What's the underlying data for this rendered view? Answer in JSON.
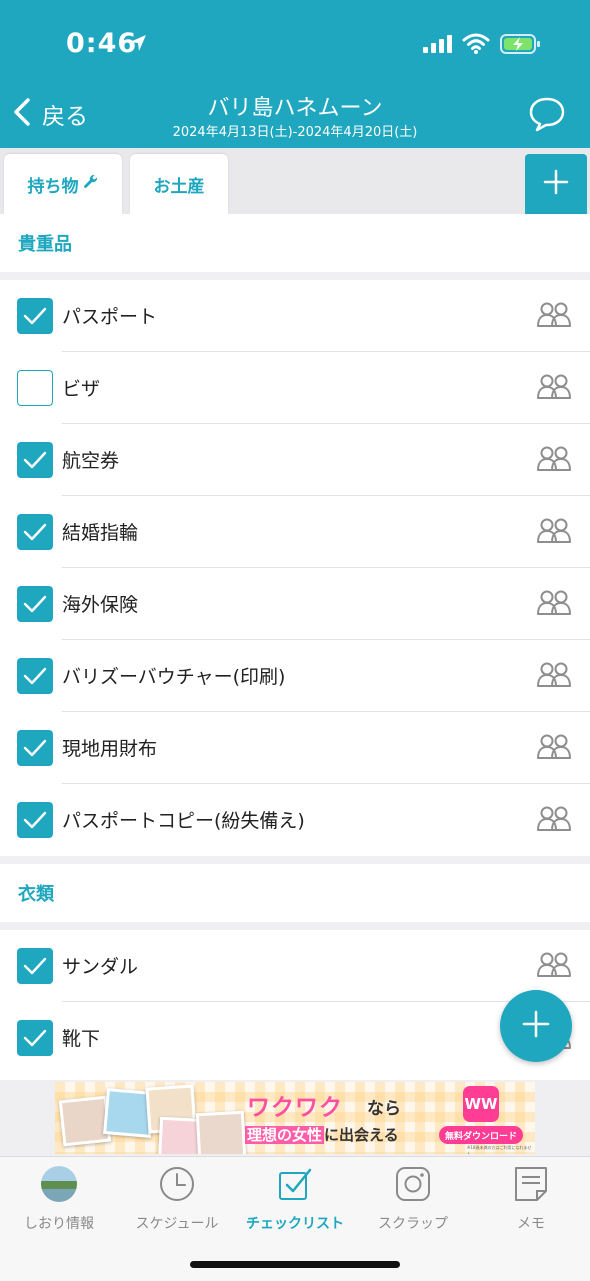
{
  "status_bar": {
    "time": "0:46"
  },
  "header": {
    "back_label": "戻る",
    "title": "バリ島ハネムーン",
    "dates": "2024年4月13日(土)-2024年4月20日(土)"
  },
  "tabs": [
    {
      "label": "持ち物"
    },
    {
      "label": "お土産"
    }
  ],
  "sections": [
    {
      "title": "貴重品",
      "items": [
        {
          "label": "パスポート",
          "checked": true
        },
        {
          "label": "ビザ",
          "checked": false
        },
        {
          "label": "航空券",
          "checked": true
        },
        {
          "label": "結婚指輪",
          "checked": true
        },
        {
          "label": "海外保険",
          "checked": true
        },
        {
          "label": "バリズーバウチャー(印刷)",
          "checked": true
        },
        {
          "label": "現地用財布",
          "checked": true
        },
        {
          "label": "パスポートコピー(紛失備え)",
          "checked": true
        }
      ]
    },
    {
      "title": "衣類",
      "items": [
        {
          "label": "サンダル",
          "checked": true
        },
        {
          "label": "靴下",
          "checked": true
        }
      ]
    }
  ],
  "ad": {
    "brand": "ワクワク",
    "nara": "なら",
    "tagline_pre": "理想の女性",
    "tagline_post": "に出会える",
    "logo": "WW",
    "download": "無料ダウンロード",
    "note": "※18歳未満の方はご利用になれません"
  },
  "bottom_nav": [
    {
      "label": "しおり情報"
    },
    {
      "label": "スケジュール"
    },
    {
      "label": "チェックリスト"
    },
    {
      "label": "スクラップ"
    },
    {
      "label": "メモ"
    }
  ],
  "colors": {
    "accent": "#1ea7bf",
    "ad_pink": "#ff3d95"
  },
  "icons": [
    "location-arrow-icon",
    "signal-icon",
    "wifi-icon",
    "battery-charging-icon",
    "back-chevron-icon",
    "chat-bubble-icon",
    "wrench-icon",
    "plus-icon",
    "checkmark-icon",
    "people-icon",
    "clock-icon",
    "checklist-icon",
    "camera-icon",
    "memo-icon"
  ]
}
